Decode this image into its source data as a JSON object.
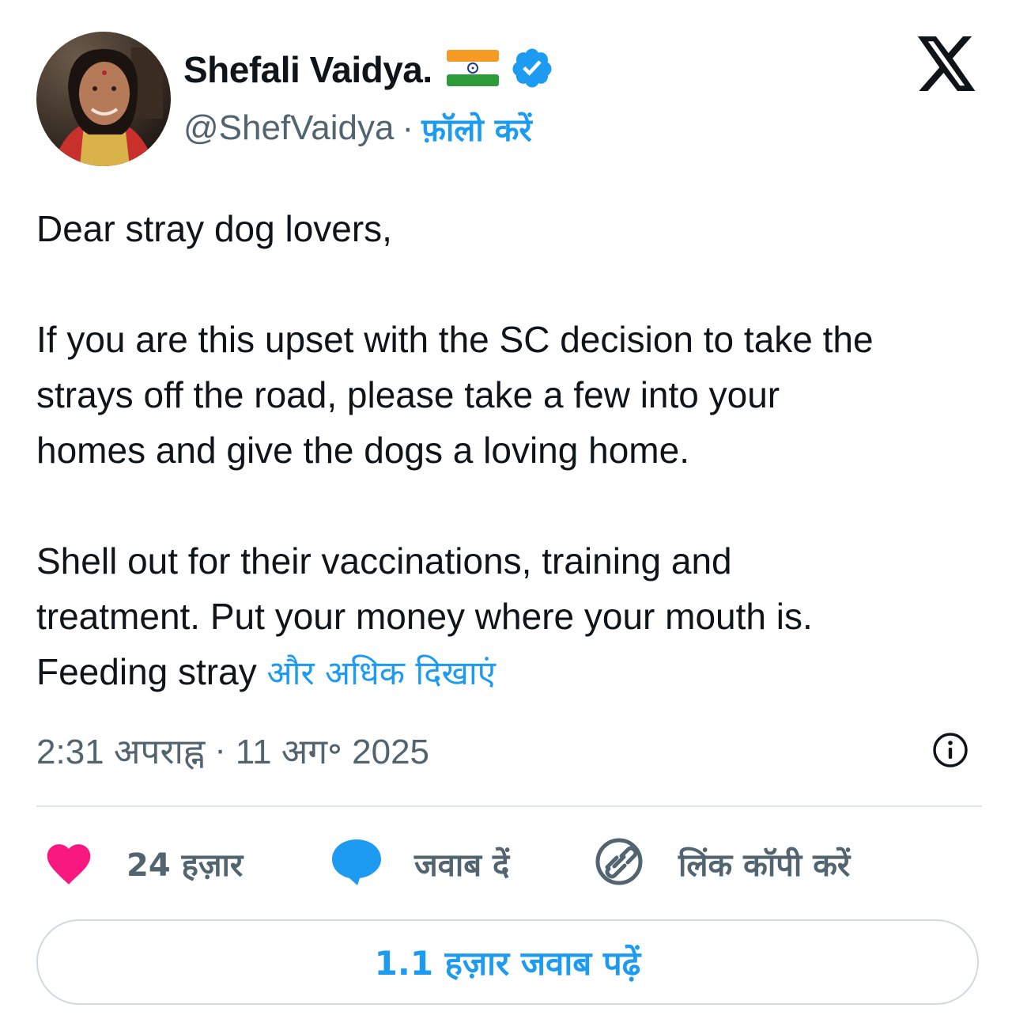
{
  "author": {
    "display_name": "Shefali Vaidya.",
    "handle": "@ShefVaidya",
    "separator": "·",
    "follow_label": "फ़ॉलो करें",
    "flag_icon": "india-flag-icon",
    "verified_icon": "verified-badge-icon",
    "verified_color": "#1d9bf0"
  },
  "brand": {
    "logo": "x-logo-icon"
  },
  "tweet": {
    "paragraph_1": "Dear stray dog lovers,",
    "paragraph_2_line_1": "If you are this upset with the SC decision to take the",
    "paragraph_2_line_2": "strays off the road, please take a few into your",
    "paragraph_2_line_3": "homes and give the dogs a loving home.",
    "paragraph_3_line_1": "Shell out for their vaccinations, training and",
    "paragraph_3_line_2": "treatment. Put your money where your mouth is.",
    "paragraph_3_line_3": "Feeding stray",
    "show_more_label": "और अधिक दिखाएं"
  },
  "meta": {
    "time": "2:31 अपराह्न",
    "separator": "·",
    "date": "11 अग॰ 2025",
    "info_icon": "info-icon"
  },
  "actions": {
    "like_count": "24 हज़ार",
    "like_icon": "heart-icon",
    "like_color": "#f91880",
    "reply_label": "जवाब दें",
    "reply_icon": "speech-bubble-icon",
    "copy_link_label": "लिंक कॉपी करें",
    "copy_link_icon": "link-icon"
  },
  "read_replies_label": "1.1 हज़ार जवाब पढ़ें",
  "colors": {
    "accent": "#1d9bf0",
    "text": "#0f1419",
    "muted": "#536471",
    "border": "#cfd9de"
  }
}
